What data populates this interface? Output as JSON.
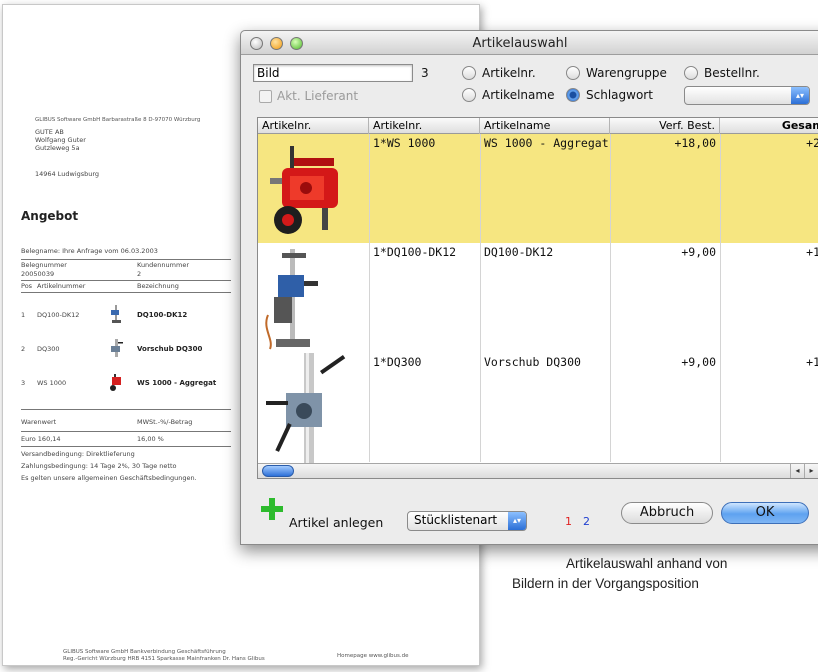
{
  "document": {
    "sender_line": "GLIBUS Software GmbH Barbarastraße 8 D-97070 Würzburg",
    "address": [
      "GUTE AB",
      "Wolfgang Guter",
      "Gutzleweg 5a",
      "14964 Ludwigsburg"
    ],
    "heading": "Angebot",
    "reference": "Belegname: Ihre Anfrage vom 06.03.2003",
    "belegnummer_label": "Belegnummer",
    "belegnummer_value": "20050039",
    "kundennummer_label": "Kundennummer",
    "kundennummer_value": "2",
    "col_pos": "Pos",
    "col_artikel": "Artikelnummer",
    "col_bezeichnung": "Bezeichnung",
    "positions": [
      {
        "pos": "1",
        "artikel": "DQ100-DK12",
        "bezeichnung": "DQ100-DK12"
      },
      {
        "pos": "2",
        "artikel": "DQ300",
        "bezeichnung": "Vorschub DQ300"
      },
      {
        "pos": "3",
        "artikel": "WS 1000",
        "bezeichnung": "WS 1000 - Aggregat"
      }
    ],
    "warenwert_label": "Warenwert",
    "mwst_label": "MWSt.-%/-Betrag",
    "warenwert_value": "Euro 160,14",
    "mwst_value": "16,00 %",
    "versand": "Versandbedingung:  Direktlieferung",
    "zahlung": "Zahlungsbedingung:  14 Tage 2%, 30 Tage netto",
    "agb": "Es gelten unsere allgemeinen Geschäftsbedingungen.",
    "footer_1": "GLIBUS Software GmbH  Bankverbindung  Geschäftsführung",
    "footer_2": "Reg.-Gericht Würzburg HRB 4151  Sparkasse Mainfranken  Dr. Hans Glibus",
    "footer_3": "Homepage www.glibus.de"
  },
  "caption": {
    "line1": "Artikelauswahl anhand von",
    "line2": "Bildern in der Vorgangsposition"
  },
  "dialog": {
    "title": "Artikelauswahl",
    "search_value": "Bild",
    "result_count": "3",
    "akt_lieferant_label": "Akt. Lieferant",
    "radio_artikelnr": "Artikelnr.",
    "radio_warengruppe": "Warengruppe",
    "radio_bestellnr": "Bestellnr.",
    "radio_artikelname": "Artikelname",
    "radio_schlagwort": "Schlagwort",
    "selected_radio": "Schlagwort",
    "filter_popup_value": "",
    "columns": [
      "Artikelnr.",
      "Artikelnr.",
      "Artikelname",
      "Verf. Best.",
      "Gesamt"
    ],
    "rows": [
      {
        "artikelnr": "1*WS 1000",
        "artikelname": "WS 1000 - Aggregat",
        "verf_best": "+18,00",
        "gesamt": "+2",
        "selected": true,
        "image": "red-pump-aggregate"
      },
      {
        "artikelnr": "1*DQ100-DK12",
        "artikelname": "DQ100-DK12",
        "verf_best": "+9,00",
        "gesamt": "+1",
        "selected": false,
        "image": "core-drill-stand"
      },
      {
        "artikelnr": "1*DQ300",
        "artikelname": "Vorschub DQ300",
        "verf_best": "+9,00",
        "gesamt": "+1",
        "selected": false,
        "image": "drill-feed-unit"
      }
    ],
    "artikel_anlegen_label": "Artikel anlegen",
    "stuecklistenart_label": "Stücklistenart",
    "page_1": "1",
    "page_2": "2",
    "cancel_label": "Abbruch",
    "ok_label": "OK",
    "colors": {
      "selection": "#f6e681",
      "page1": "#e02020",
      "page2": "#2040d0",
      "ok_button": "#5ea2f0"
    }
  }
}
